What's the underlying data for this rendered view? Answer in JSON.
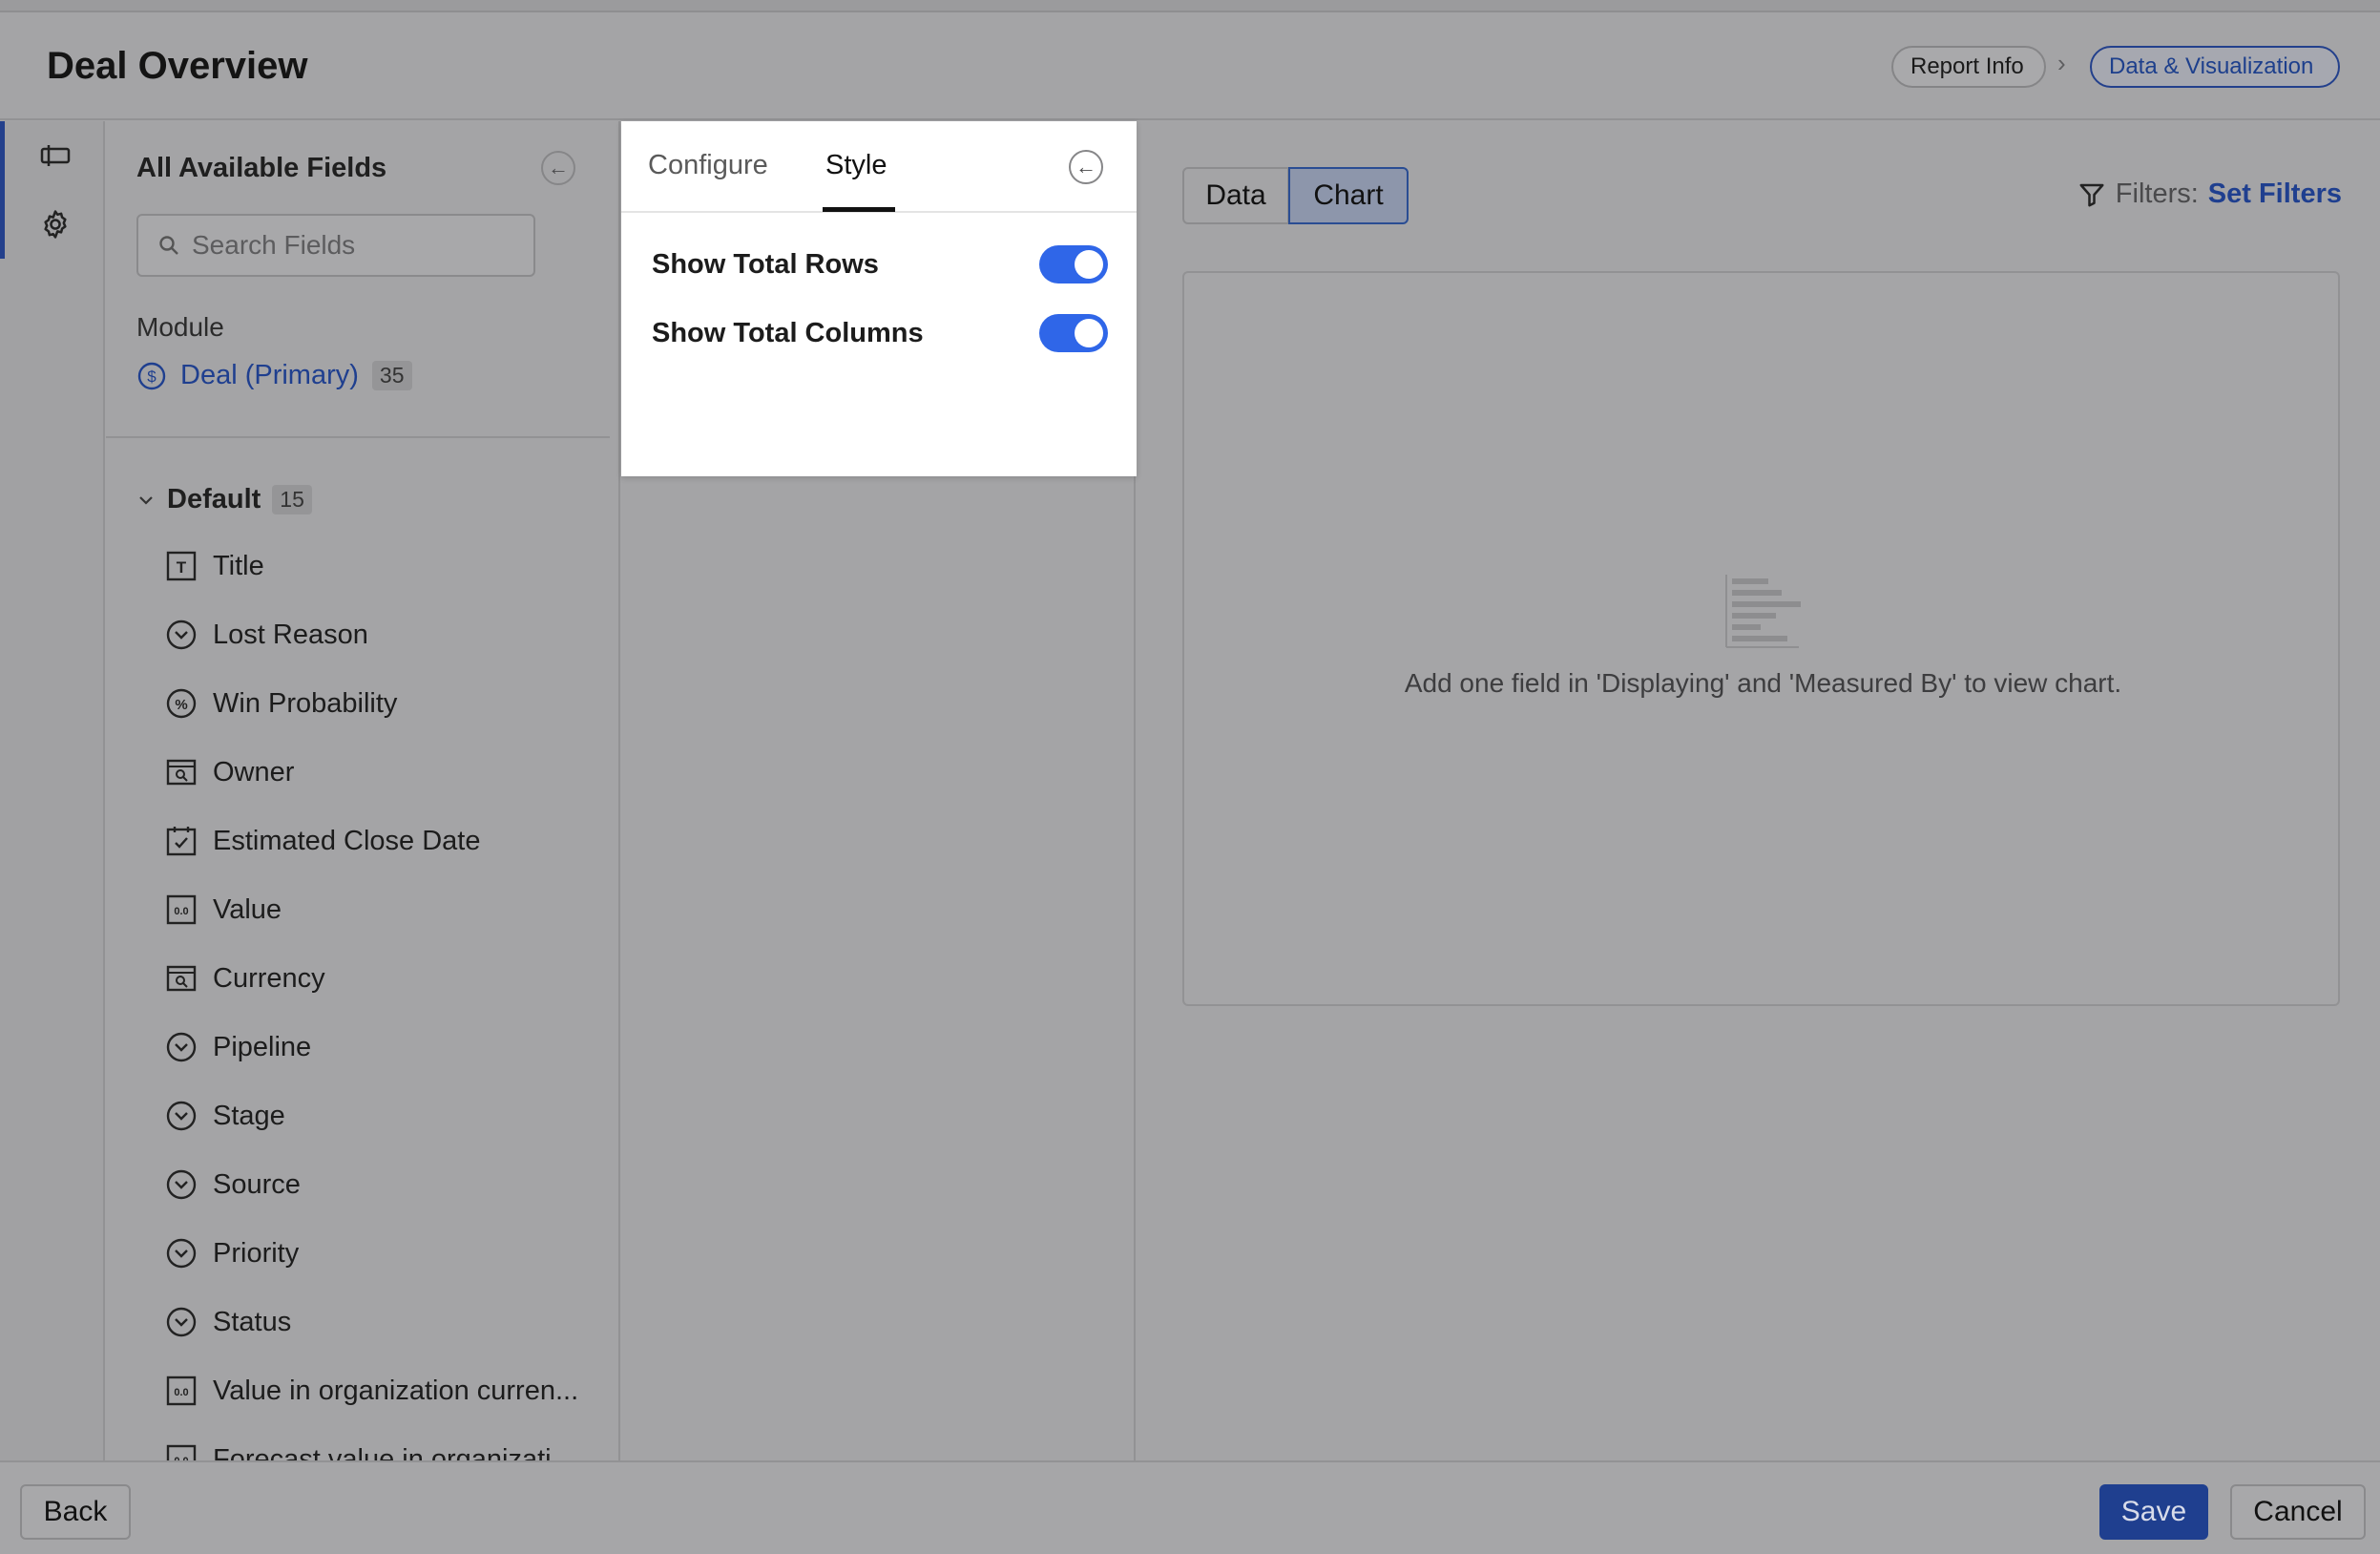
{
  "header": {
    "title": "Deal Overview",
    "breadcrumb": [
      "Report Info",
      "Data & Visualization"
    ],
    "breadcrumb_separator": "›"
  },
  "rail": {
    "items": [
      {
        "icon": "report-layout-icon"
      },
      {
        "icon": "gear-icon"
      }
    ]
  },
  "fields_panel": {
    "title": "All Available Fields",
    "search_placeholder": "Search Fields",
    "module_label": "Module",
    "module_name": "Deal (Primary)",
    "module_count": "35",
    "group_name": "Default",
    "group_count": "15",
    "items": [
      {
        "label": "Title",
        "icon": "text-field-icon"
      },
      {
        "label": "Lost Reason",
        "icon": "dropdown-field-icon"
      },
      {
        "label": "Win Probability",
        "icon": "percent-field-icon"
      },
      {
        "label": "Owner",
        "icon": "lookup-field-icon"
      },
      {
        "label": "Estimated Close Date",
        "icon": "date-field-icon"
      },
      {
        "label": "Value",
        "icon": "number-field-icon"
      },
      {
        "label": "Currency",
        "icon": "lookup-field-icon"
      },
      {
        "label": "Pipeline",
        "icon": "dropdown-field-icon"
      },
      {
        "label": "Stage",
        "icon": "dropdown-field-icon"
      },
      {
        "label": "Source",
        "icon": "dropdown-field-icon"
      },
      {
        "label": "Priority",
        "icon": "dropdown-field-icon"
      },
      {
        "label": "Status",
        "icon": "dropdown-field-icon"
      },
      {
        "label": "Value in organization curren...",
        "icon": "number-field-icon"
      },
      {
        "label": "Forecast value in organizati...",
        "icon": "number-field-icon"
      }
    ]
  },
  "style_panel": {
    "tabs": [
      "Configure",
      "Style"
    ],
    "active_tab": "Style",
    "toggles": [
      {
        "label": "Show Total Rows",
        "on": true
      },
      {
        "label": "Show Total Columns",
        "on": true
      }
    ]
  },
  "main": {
    "view_toggle": [
      "Data",
      "Chart"
    ],
    "active_view": "Chart",
    "filters_label": "Filters:",
    "set_filters": "Set Filters",
    "empty_message": "Add one field in 'Displaying' and 'Measured By' to view chart."
  },
  "footer": {
    "back": "Back",
    "save": "Save",
    "cancel": "Cancel"
  },
  "colors": {
    "accent": "#2f66e8",
    "brand_dark": "#1f3f8f",
    "overlay_bg": "#a4a4a6"
  }
}
